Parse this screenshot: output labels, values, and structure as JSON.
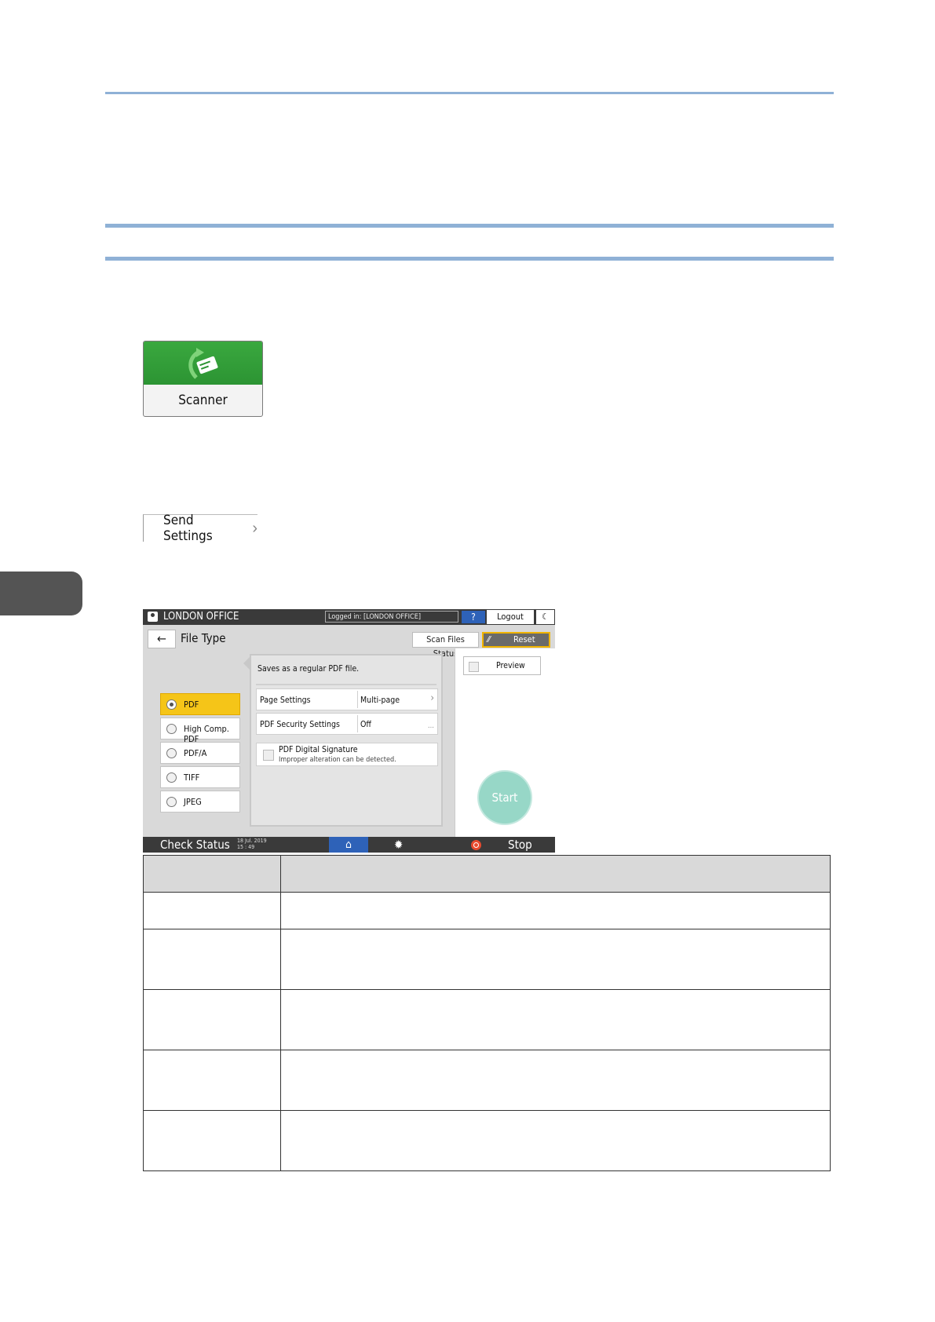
{
  "scanner_icon": {
    "label": "Scanner"
  },
  "send_settings": {
    "label": "Send Settings",
    "chevron": "chevron-right-icon"
  },
  "device_screen": {
    "top_bar": {
      "office": "LONDON OFFICE",
      "logged_in": "Logged in: [LONDON OFFICE]",
      "help": "?",
      "logout": "Logout"
    },
    "header": {
      "title": "File Type",
      "scan_files_status": "Scan Files Status",
      "reset": "Reset"
    },
    "file_types": [
      {
        "label": "PDF",
        "selected": true
      },
      {
        "label": "High Comp. PDF",
        "selected": false
      },
      {
        "label": "PDF/A",
        "selected": false
      },
      {
        "label": "TIFF",
        "selected": false
      },
      {
        "label": "JPEG",
        "selected": false
      }
    ],
    "details": {
      "description": "Saves as a regular PDF file.",
      "rows": [
        {
          "key": "Page Settings",
          "value": "Multi-page"
        },
        {
          "key": "PDF Security Settings",
          "value": "Off"
        }
      ],
      "digital_signature": {
        "title": "PDF Digital Signature",
        "subtitle": "Improper alteration can be detected."
      }
    },
    "preview": "Preview",
    "start": "Start",
    "bottom_bar": {
      "check_status": "Check Status",
      "date": "18 Jul. 2019",
      "time": "15 : 49",
      "stop": "Stop"
    }
  },
  "colors": {
    "rule": "#8fb1d6",
    "scanner_green": "#2c9433",
    "selected_yellow": "#f5c518",
    "help_blue": "#2e62b8",
    "start_teal": "#97d7c7",
    "stop_red": "#e84a2e"
  }
}
